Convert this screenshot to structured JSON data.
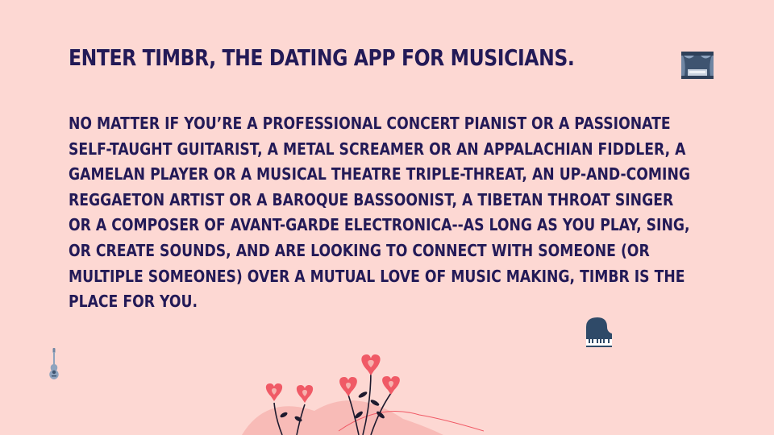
{
  "slide": {
    "title_pre": "Enter ",
    "title_brand": "Timbr",
    "title_post": ", the dating app for musicians.",
    "body": "No matter if you’re a professional concert pianist or a passionate self-taught guitarist, a metal screamer or an Appalachian fiddler, a gamelan player or a musical theatre triple-threat, an up-and-coming reggaeton artist or a Baroque bassoonist, a Tibetan throat singer or a composer of avant-garde electronica--as long as you play, sing, or create sounds, and are looking to connect with someone (or multiple someones) over a mutual love of music making, Timbr is the place for you."
  },
  "colors": {
    "background": "#FDD8D3",
    "text": "#231A57",
    "accent_red": "#F05A66",
    "accent_pink": "#F6B2AE"
  },
  "icons": {
    "top_right": "stage-curtain-icon",
    "piano": "grand-piano-icon",
    "guitar": "ukulele-icon",
    "decoration": "heart-flowers-illustration"
  }
}
